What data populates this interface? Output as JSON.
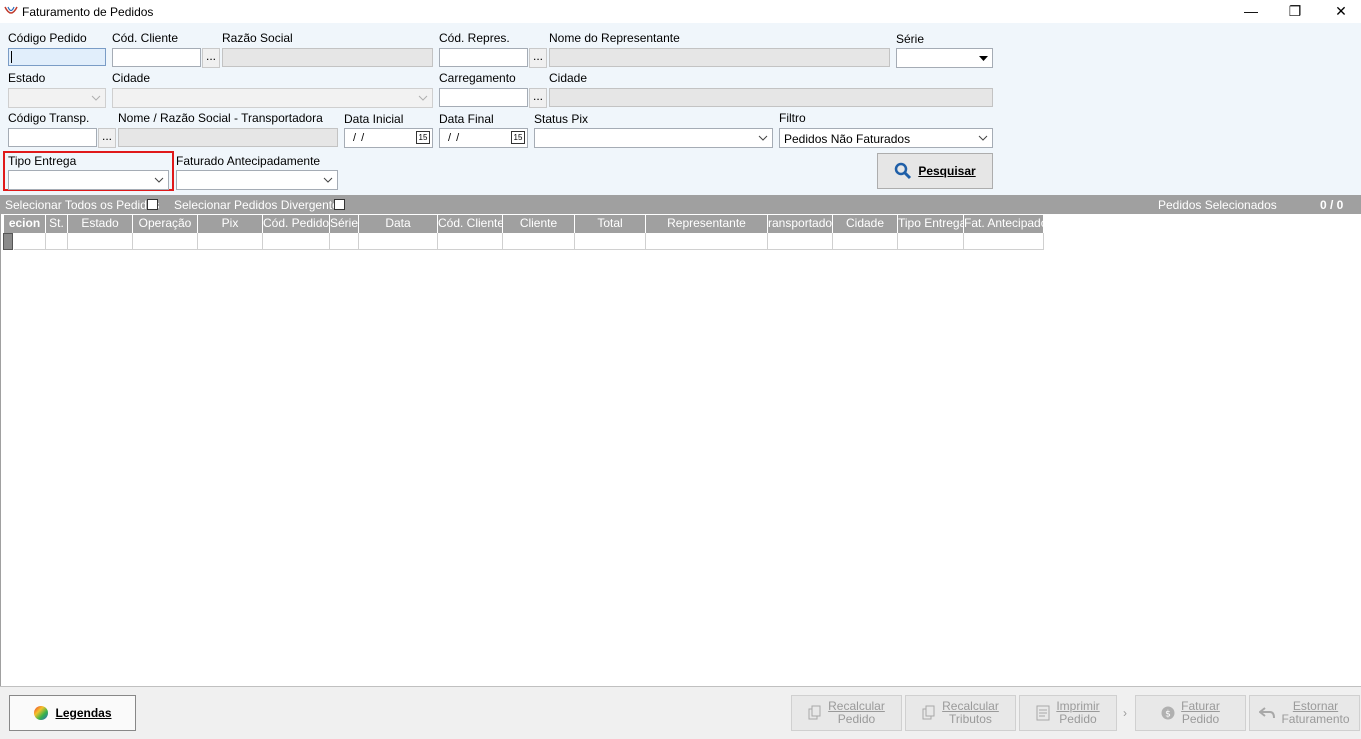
{
  "window": {
    "title": "Faturamento de Pedidos",
    "minimize": "—",
    "restore": "❐",
    "close": "✕"
  },
  "form": {
    "codigo_pedido_label": "Código Pedido",
    "cod_cliente_label": "Cód. Cliente",
    "razao_social_label": "Razão Social",
    "cod_repres_label": "Cód. Repres.",
    "nome_representante_label": "Nome do Representante",
    "serie_label": "Série",
    "estado_label": "Estado",
    "cidade_label": "Cidade",
    "carregamento_label": "Carregamento",
    "cidade2_label": "Cidade",
    "codigo_transp_label": "Código Transp.",
    "nome_transp_label": "Nome / Razão Social - Transportadora",
    "data_inicial_label": "Data Inicial",
    "data_final_label": "Data Final",
    "status_pix_label": "Status Pix",
    "filtro_label": "Filtro",
    "filtro_value": "Pedidos Não Faturados",
    "tipo_entrega_label": "Tipo Entrega",
    "faturado_antecipadamente_label": "Faturado Antecipadamente",
    "data_inicial_value": "/ /",
    "data_final_value": "/ /",
    "dots": "...",
    "calendar_day": "15",
    "search_label": "Pesquisar"
  },
  "selection_bar": {
    "select_all": "Selecionar Todos os Pedidos",
    "select_divergent": "Selecionar Pedidos Divergentes",
    "selected_label": "Pedidos Selecionados",
    "selected_count": "0 / 0"
  },
  "grid": {
    "columns": [
      "ecion",
      "St.",
      "Estado",
      "Operação",
      "Pix",
      "Cód. Pedido",
      "Série",
      "Data",
      "Cód. Cliente",
      "Cliente",
      "Total",
      "Representante",
      "ransportador",
      "Cidade",
      "Tipo Entrega",
      "Fat. Antecipado"
    ]
  },
  "footer": {
    "legendas": "Legendas",
    "recalcular_pedido": [
      "Recalcular",
      "Pedido"
    ],
    "recalcular_tributos": [
      "Recalcular",
      "Tributos"
    ],
    "imprimir_pedido": [
      "Imprimir",
      "Pedido"
    ],
    "faturar_pedido": [
      "Faturar",
      "Pedido"
    ],
    "estornar_faturamento": [
      "Estornar",
      "Faturamento"
    ],
    "more": "›"
  },
  "colors": {
    "accent_highlight": "#e0191a",
    "grid_header": "#a0a0a0",
    "form_bg": "#f0f6fb"
  }
}
